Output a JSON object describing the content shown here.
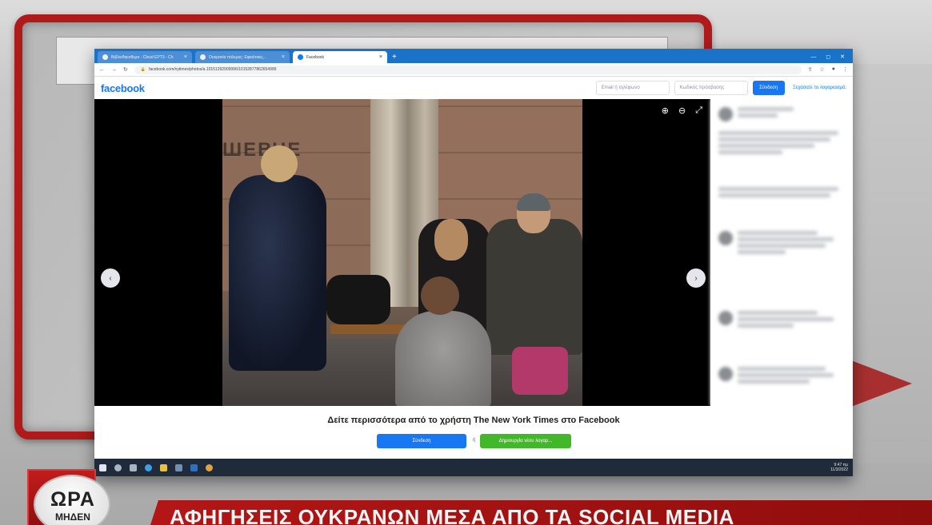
{
  "browser": {
    "tabs": [
      {
        "title": "Βιβλιοθηκοθεμα - Cloud ΕΡΤ3 - Ch"
      },
      {
        "title": "Ουκρανία πόλεμος: Εφιαλτικές..."
      },
      {
        "title": "Facebook"
      }
    ],
    "new_tab": "+",
    "window_controls": [
      "—",
      "◻",
      "✕"
    ],
    "url": "facebook.com/nytimes/photos/a.10151292909996/10152877862654999"
  },
  "facebook": {
    "logo": "facebook",
    "email_placeholder": "Email ή τηλέφωνο",
    "password_placeholder": "Κωδικός πρόσβασης",
    "login_label": "Σύνδεση",
    "forgot_label": "Ξεχάσατε το λογαριασμό;",
    "photo_sign": "ШЕВЧЕ",
    "cta_text": "Δείτε περισσότερα από το χρήστη The New York Times στο Facebook",
    "cta_login": "Σύνδεση",
    "cta_or": "ή",
    "cta_create": "Δημιουργία νέου λογαρ..."
  },
  "taskbar": {
    "clock_time": "9:47 πμ",
    "clock_date": "11/3/2022"
  },
  "broadcast": {
    "logo_line1": "ΩΡΑ",
    "logo_line2": "ΜΗΔΕΝ",
    "headline": "ΑΦΗΓΗΣΕΙΣ ΟΥΚΡΑΝΩΝ ΜΕΣΑ ΑΠΟ ΤΑ SOCIAL MEDIA"
  },
  "colors": {
    "facebook_blue": "#1877f2",
    "create_green": "#42b72a",
    "broadcast_red": "#b31616",
    "chrome_tabbar": "#1a73c9"
  },
  "icons": [
    "zoom-in-icon",
    "zoom-out-icon",
    "fullscreen-icon",
    "chevron-left-icon",
    "chevron-right-icon"
  ]
}
